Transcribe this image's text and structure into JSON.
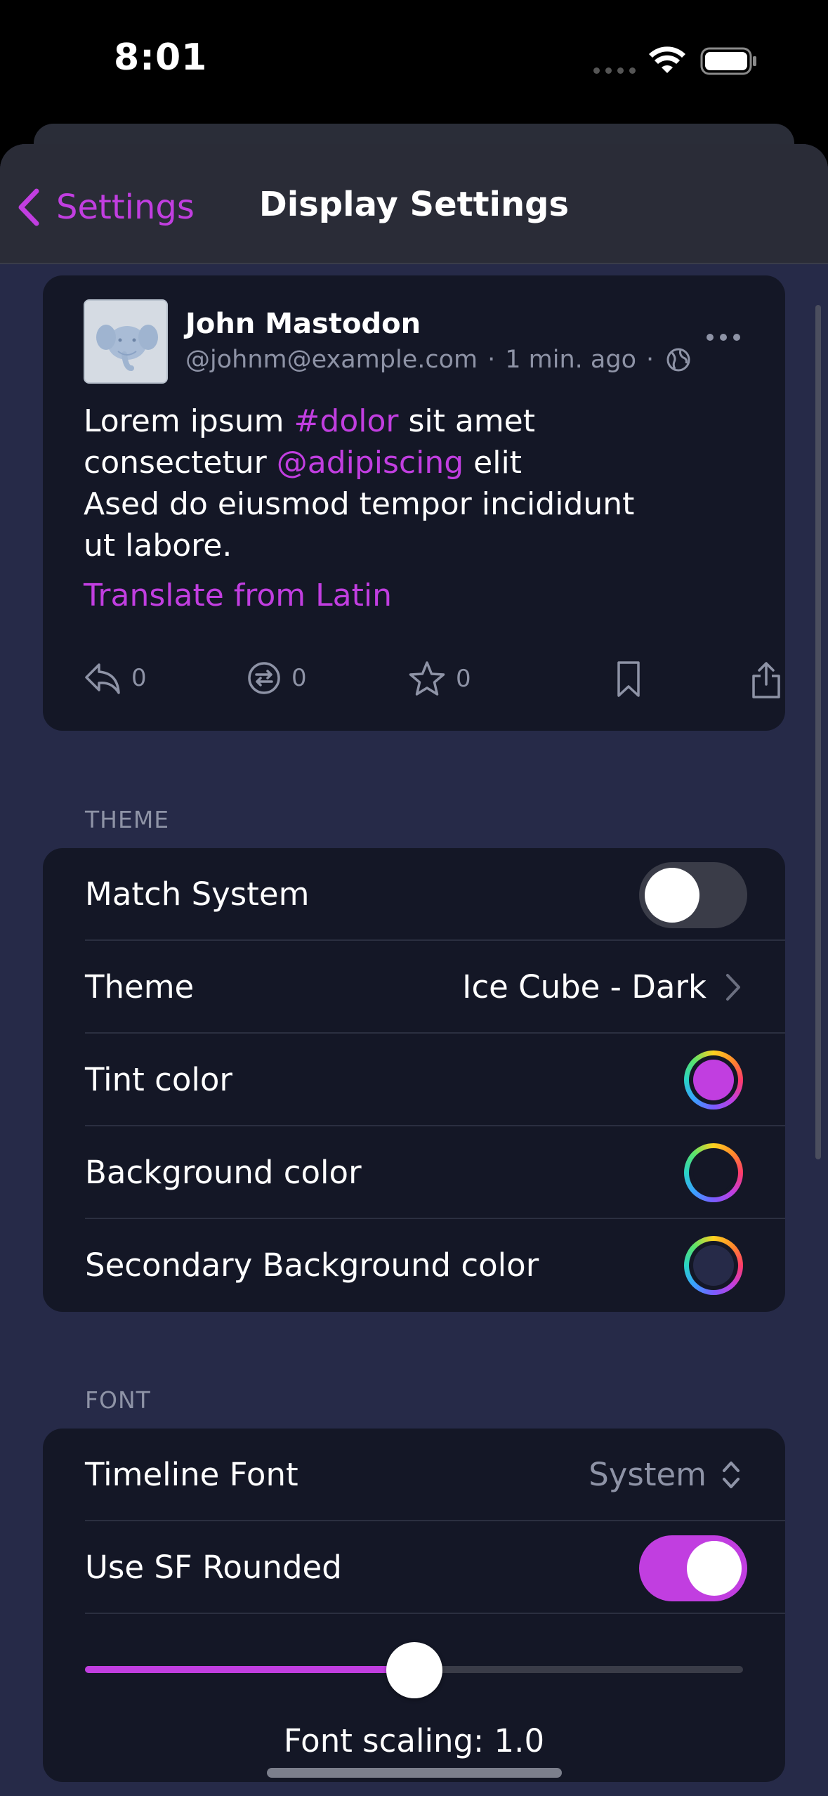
{
  "status_bar": {
    "time": "8:01"
  },
  "navbar": {
    "back_label": "Settings",
    "title": "Display Settings"
  },
  "post": {
    "author_name": "John Mastodon",
    "handle": "@johnm@example.com",
    "time": "1 min. ago",
    "dot": "·",
    "text": {
      "l1_a": "Lorem ipsum ",
      "l1_tag": "#dolor",
      "l1_b": " sit amet",
      "l2_a": "consectetur ",
      "l2_mention": "@adipiscing",
      "l2_b": " elit",
      "l3": "Ased do eiusmod tempor incididunt",
      "l4": "ut labore."
    },
    "translate": "Translate from Latin",
    "replies": "0",
    "boosts": "0",
    "favorites": "0"
  },
  "theme_section": {
    "header": "THEME",
    "match_system": {
      "label": "Match System",
      "on": false
    },
    "theme": {
      "label": "Theme",
      "value": "Ice Cube - Dark"
    },
    "tint": {
      "label": "Tint color",
      "color": "#c13ee0"
    },
    "background": {
      "label": "Background color",
      "color": "#141726"
    },
    "secondary_background": {
      "label": "Secondary Background color",
      "color": "#262a48"
    }
  },
  "font_section": {
    "header": "FONT",
    "timeline_font": {
      "label": "Timeline Font",
      "value": "System"
    },
    "sf_rounded": {
      "label": "Use SF Rounded",
      "on": true
    },
    "slider_fraction": 0.5,
    "font_scaling": "Font scaling: 1.0"
  },
  "colors": {
    "accent": "#c13ee0",
    "background": "#262a48",
    "card": "#141726",
    "secondary_text": "#8e93a6"
  }
}
